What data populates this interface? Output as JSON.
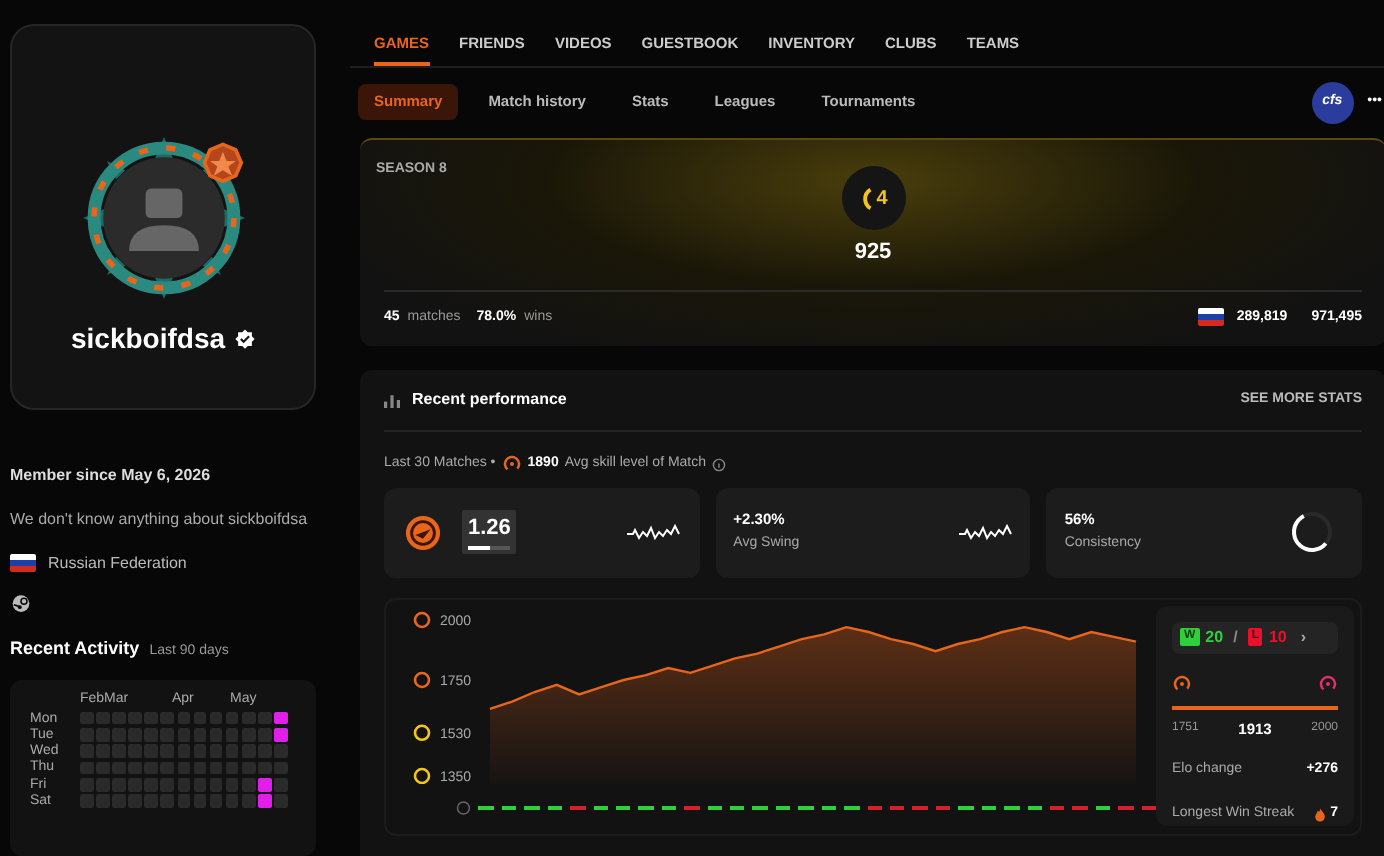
{
  "profile": {
    "username": "sickboifdsa",
    "verified": true,
    "member_since": "Member since May 6, 2026",
    "bio": "We don't know anything about sickboifdsa",
    "country": "Russian Federation"
  },
  "activity": {
    "title": "Recent Activity",
    "subtitle": "Last 90 days",
    "months": [
      "Feb",
      "Mar",
      "Apr",
      "May"
    ],
    "rows": [
      {
        "day": "Mon",
        "active": [
          false,
          false,
          false,
          false,
          false,
          false,
          false,
          false,
          false,
          false,
          false,
          false,
          true
        ]
      },
      {
        "day": "Tue",
        "active": [
          false,
          false,
          false,
          false,
          false,
          false,
          false,
          false,
          false,
          false,
          false,
          false,
          true
        ]
      },
      {
        "day": "Wed",
        "active": [
          false,
          false,
          false,
          false,
          false,
          false,
          false,
          false,
          false,
          false,
          false,
          false,
          false
        ]
      },
      {
        "day": "Thu",
        "active": [
          false,
          false,
          false,
          false,
          false,
          false,
          false,
          false,
          false,
          false,
          false,
          false,
          false
        ]
      },
      {
        "day": "Fri",
        "active": [
          false,
          false,
          false,
          false,
          false,
          false,
          false,
          false,
          false,
          false,
          false,
          true,
          false
        ]
      },
      {
        "day": "Sat",
        "active": [
          false,
          false,
          false,
          false,
          false,
          false,
          false,
          false,
          false,
          false,
          false,
          true,
          false
        ]
      }
    ]
  },
  "nav_tabs": [
    {
      "label": "GAMES",
      "selected": true
    },
    {
      "label": "FRIENDS",
      "selected": false
    },
    {
      "label": "VIDEOS",
      "selected": false
    },
    {
      "label": "GUESTBOOK",
      "selected": false
    },
    {
      "label": "INVENTORY",
      "selected": false
    },
    {
      "label": "CLUBS",
      "selected": false
    },
    {
      "label": "TEAMS",
      "selected": false
    }
  ],
  "sub_tabs": [
    {
      "label": "Summary",
      "selected": true
    },
    {
      "label": "Match history",
      "selected": false
    },
    {
      "label": "Stats",
      "selected": false
    },
    {
      "label": "Leagues",
      "selected": false
    },
    {
      "label": "Tournaments",
      "selected": false
    }
  ],
  "game_badge": "cfs",
  "more_button": "•••",
  "season": {
    "title": "SEASON 8",
    "level_badge": "4",
    "elo": "925",
    "matches": "45",
    "matches_label": "matches",
    "winrate": "78.0%",
    "winrate_label": "wins",
    "country_rank": "289,819",
    "global_rank": "971,495"
  },
  "performance": {
    "title": "Recent performance",
    "see_more": "SEE MORE STATS",
    "scope": "Last 30 Matches •",
    "avg_skill": "1890",
    "avg_skill_label": "Avg skill level of Match",
    "kd": {
      "value": "1.26",
      "level": 0.5
    },
    "swing": {
      "value": "+2.30%",
      "label": "Avg Swing"
    },
    "consistency": {
      "value": "56%",
      "label": "Consistency",
      "level": 0.56
    },
    "chart_data": {
      "type": "area",
      "series": [
        {
          "color": "#e8651c",
          "values": [
            1630,
            1660,
            1700,
            1730,
            1690,
            1720,
            1750,
            1770,
            1800,
            1780,
            1810,
            1840,
            1860,
            1890,
            1920,
            1940,
            1970,
            1950,
            1920,
            1900,
            1870,
            1900,
            1920,
            1950,
            1970,
            1950,
            1920,
            1950,
            1930,
            1910
          ]
        }
      ],
      "ylim": [
        1350,
        2000
      ],
      "yticks": [
        2000,
        1750,
        1530,
        1350
      ]
    },
    "results": [
      {
        "won": true
      },
      {
        "won": true
      },
      {
        "won": true
      },
      {
        "won": true
      },
      {
        "won": false
      },
      {
        "won": true
      },
      {
        "won": true
      },
      {
        "won": true
      },
      {
        "won": true
      },
      {
        "won": false
      },
      {
        "won": true
      },
      {
        "won": true
      },
      {
        "won": true
      },
      {
        "won": true
      },
      {
        "won": true
      },
      {
        "won": true
      },
      {
        "won": true
      },
      {
        "won": false
      },
      {
        "won": false
      },
      {
        "won": false
      },
      {
        "won": false
      },
      {
        "won": true
      },
      {
        "won": true
      },
      {
        "won": true
      },
      {
        "won": true
      },
      {
        "won": false
      },
      {
        "won": false
      },
      {
        "won": true
      },
      {
        "won": false
      },
      {
        "won": false
      }
    ],
    "record": {
      "w_label": "W",
      "wins": "20",
      "separator": "/",
      "l_label": "L",
      "losses": "10",
      "chevron": "›"
    },
    "elo_range": {
      "from": "1751",
      "current": "1913",
      "to": "2000"
    },
    "elo_change_label": "Elo change",
    "elo_change": "+276",
    "streak_label": "Longest Win Streak",
    "streak": "7"
  }
}
